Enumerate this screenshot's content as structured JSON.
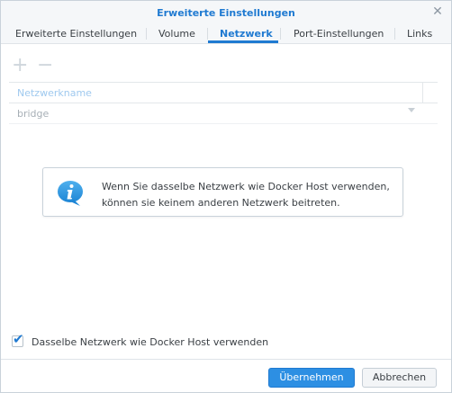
{
  "dialog": {
    "title": "Erweiterte Einstellungen",
    "close_icon": "close-icon"
  },
  "tabs": [
    {
      "label": "Erweiterte Einstellungen",
      "active": false
    },
    {
      "label": "Volume",
      "active": false
    },
    {
      "label": "Netzwerk",
      "active": true
    },
    {
      "label": "Port-Einstellungen",
      "active": false
    },
    {
      "label": "Links",
      "active": false
    }
  ],
  "toolbar": {
    "add_icon": "plus",
    "remove_icon": "minus"
  },
  "grid": {
    "column_header": "Netzwerkname",
    "rows": [
      {
        "name": "bridge"
      }
    ]
  },
  "info": {
    "icon": "info-speech-bubble-icon",
    "line1": "Wenn Sie dasselbe Netzwerk wie Docker Host verwenden,",
    "line2": "können sie keinem anderen Netzwerk beitreten."
  },
  "checkbox": {
    "label": "Dasselbe Netzwerk wie Docker Host verwenden",
    "checked": true
  },
  "buttons": {
    "apply": "Übernehmen",
    "cancel": "Abbrechen"
  },
  "colors": {
    "accent": "#1f7ad1",
    "primary_button": "#2d8fe3"
  }
}
